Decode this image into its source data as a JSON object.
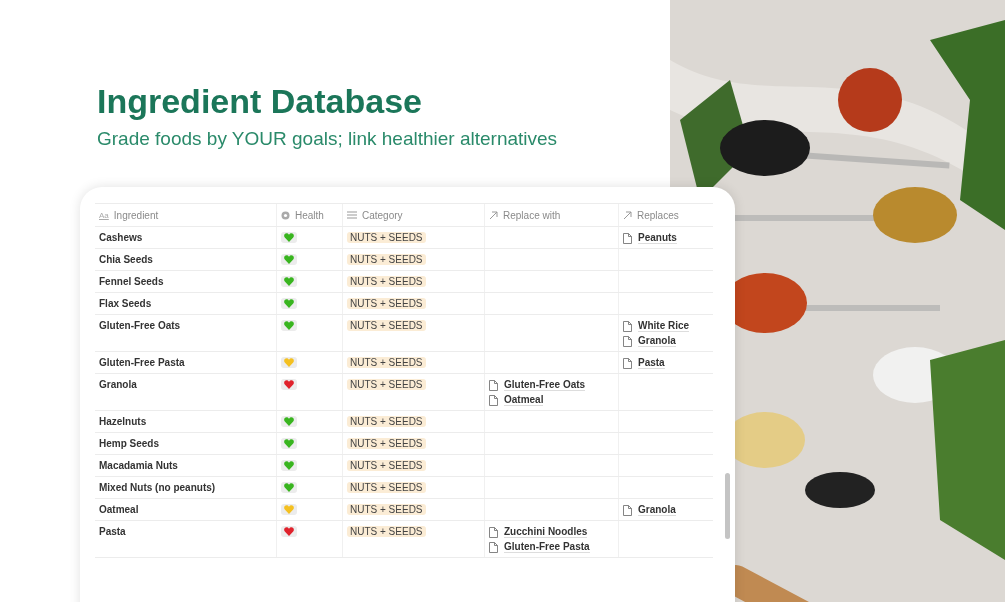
{
  "header": {
    "title": "Ingredient Database",
    "subtitle": "Grade foods by YOUR goals; link healthier alternatives"
  },
  "table": {
    "columns": [
      {
        "label": "Ingredient",
        "kind": "title",
        "icon_text": "Aa"
      },
      {
        "label": "Health",
        "kind": "select"
      },
      {
        "label": "Category",
        "kind": "list"
      },
      {
        "label": "Replace with",
        "kind": "relation"
      },
      {
        "label": "Replaces",
        "kind": "relation"
      }
    ],
    "rows": [
      {
        "name": "Cashews",
        "color": "#39b51f",
        "category": "NUTS + SEEDS",
        "replace_with": [],
        "replaces": [
          "Peanuts"
        ]
      },
      {
        "name": "Chia Seeds",
        "color": "#39b51f",
        "category": "NUTS + SEEDS",
        "replace_with": [],
        "replaces": []
      },
      {
        "name": "Fennel Seeds",
        "color": "#39b51f",
        "category": "NUTS + SEEDS",
        "replace_with": [],
        "replaces": []
      },
      {
        "name": "Flax Seeds",
        "color": "#39b51f",
        "category": "NUTS + SEEDS",
        "replace_with": [],
        "replaces": []
      },
      {
        "name": "Gluten-Free Oats",
        "color": "#39b51f",
        "category": "NUTS + SEEDS",
        "replace_with": [],
        "replaces": [
          "White Rice",
          "Granola"
        ]
      },
      {
        "name": "Gluten-Free Pasta",
        "color": "#f4c020",
        "category": "NUTS + SEEDS",
        "replace_with": [],
        "replaces": [
          "Pasta"
        ]
      },
      {
        "name": "Granola",
        "color": "#e0222c",
        "category": "NUTS + SEEDS",
        "replace_with": [
          "Gluten-Free Oats",
          "Oatmeal"
        ],
        "replaces": []
      },
      {
        "name": "Hazelnuts",
        "color": "#39b51f",
        "category": "NUTS + SEEDS",
        "replace_with": [],
        "replaces": []
      },
      {
        "name": "Hemp Seeds",
        "color": "#39b51f",
        "category": "NUTS + SEEDS",
        "replace_with": [],
        "replaces": []
      },
      {
        "name": "Macadamia Nuts",
        "color": "#39b51f",
        "category": "NUTS + SEEDS",
        "replace_with": [],
        "replaces": []
      },
      {
        "name": "Mixed Nuts (no peanuts)",
        "color": "#39b51f",
        "category": "NUTS + SEEDS",
        "replace_with": [],
        "replaces": []
      },
      {
        "name": "Oatmeal",
        "color": "#f4c020",
        "category": "NUTS + SEEDS",
        "replace_with": [],
        "replaces": [
          "Granola"
        ]
      },
      {
        "name": "Pasta",
        "color": "#e0222c",
        "category": "NUTS + SEEDS",
        "replace_with": [
          "Zucchini Noodles",
          "Gluten-Free Pasta"
        ],
        "replaces": []
      }
    ]
  }
}
